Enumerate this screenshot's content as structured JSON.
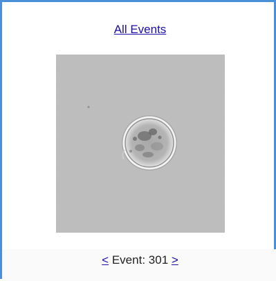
{
  "header": {
    "all_events_link": "All Events"
  },
  "navigation": {
    "prev_label": "<",
    "event_label": "Event:",
    "event_number": "301",
    "next_label": ">"
  },
  "colors": {
    "frame_border": "#4a90d9",
    "link": "#1a0dab"
  }
}
